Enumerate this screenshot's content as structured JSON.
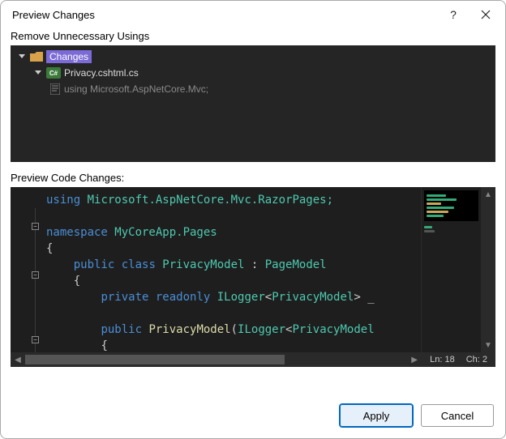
{
  "dialog": {
    "title": "Preview Changes",
    "help": "?",
    "close": "✕"
  },
  "section1_label": "Remove Unnecessary Usings",
  "tree": {
    "root": {
      "label": "Changes"
    },
    "file": {
      "badge": "C#",
      "label": "Privacy.cshtml.cs"
    },
    "change": {
      "label": "using Microsoft.AspNetCore.Mvc;"
    }
  },
  "section2_label": "Preview Code Changes:",
  "code": {
    "line1_kw": "using",
    "line1_rest": " Microsoft.AspNetCore.Mvc.RazorPages;",
    "line3_kw": "namespace",
    "line3_ns": " MyCoreApp.Pages",
    "line4": "{",
    "line5_kw1": "public",
    "line5_kw2": " class",
    "line5_type": " PrivacyModel",
    "line5_colon": " : ",
    "line5_base": "PageModel",
    "line6": "{",
    "line7_kw1": "private",
    "line7_kw2": " readonly",
    "line7_type": " ILogger",
    "line7_lt": "<",
    "line7_gen": "PrivacyModel",
    "line7_gt": ">",
    "line7_tail": " _",
    "line9_kw": "public",
    "line9_method": " PrivacyModel",
    "line9_paren": "(",
    "line9_ptype": "ILogger",
    "line9_lt": "<",
    "line9_gen": "PrivacyModel",
    "line10": "{"
  },
  "status": {
    "line": "Ln: 18",
    "col": "Ch: 2"
  },
  "buttons": {
    "apply": "Apply",
    "cancel": "Cancel"
  }
}
